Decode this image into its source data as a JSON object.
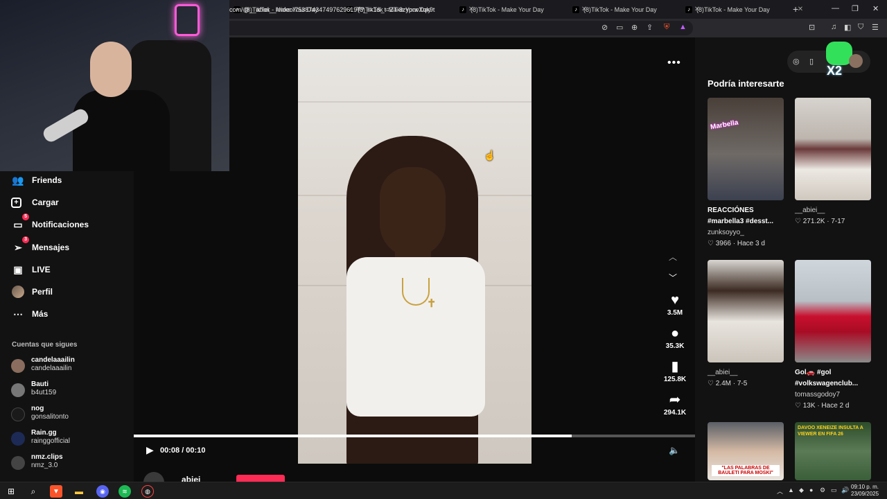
{
  "browser": {
    "tabs": [
      {
        "title": "(8)TikTok - Make Your Day"
      },
      {
        "title": "(8)TikTok - Make Your Day"
      },
      {
        "title": "(8)TikTok - Make Your Day"
      },
      {
        "title": "(8)TikTok - Make Your Day"
      },
      {
        "title": "(8)TikTok - Make Your Day"
      }
    ],
    "url": "com/@__abiei__/video/7538743474976296197?_r=1&_t=ZT-8zyprwXqk9t",
    "window_controls": {
      "minimize": "—",
      "restore": "❐",
      "close": "✕"
    }
  },
  "sidebar": {
    "nav": [
      {
        "label": "Friends",
        "icon": "friends-icon",
        "glyph": "👥"
      },
      {
        "label": "Cargar",
        "icon": "upload-icon",
        "glyph": "⊞"
      },
      {
        "label": "Notificaciones",
        "icon": "inbox-icon",
        "glyph": "💬",
        "badge": "5"
      },
      {
        "label": "Mensajes",
        "icon": "send-icon",
        "glyph": "➢",
        "badge": "3"
      },
      {
        "label": "LIVE",
        "icon": "live-icon",
        "glyph": "📺"
      },
      {
        "label": "Perfil",
        "icon": "profile-avatar-icon",
        "glyph": ""
      },
      {
        "label": "Más",
        "icon": "more-icon",
        "glyph": "⋯"
      }
    ],
    "following_title": "Cuentas que sigues",
    "following": [
      {
        "name": "candelaaailin",
        "handle": "candelaaailin"
      },
      {
        "name": "Bauti",
        "handle": "b4ut159"
      },
      {
        "name": "nog",
        "handle": "gonsalitonto"
      },
      {
        "name": "Rain.gg",
        "handle": "rainggofficial"
      },
      {
        "name": "nmz.clips",
        "handle": "nmz_3.0"
      }
    ]
  },
  "video": {
    "likes": "3.5M",
    "comments": "35.3K",
    "saves": "125.8K",
    "shares": "294.1K",
    "time": "00:08 / 00:10",
    "progress": 0.78,
    "creator": "abiei"
  },
  "recommend": {
    "title": "Podría interesarte",
    "x2": "X2",
    "cards": [
      {
        "title": "REACCIÓNES #marbella3 #desst...",
        "user": "zunksoyyo_",
        "stats": "3966 · Hace 3 d",
        "thumb_label": "Marbella"
      },
      {
        "title": "",
        "user": "__abiei__",
        "stats": "271.2K · 7-17",
        "thumb_label": ""
      },
      {
        "title": "",
        "user": "__abiei__",
        "stats": "2.4M · 7-5",
        "thumb_label": ""
      },
      {
        "title": "Gol🚗 #gol #volkswagenclub...",
        "user": "tomassgodoy7",
        "stats": "13K · Hace 2 d",
        "thumb_label": ""
      },
      {
        "title": "",
        "user": "",
        "stats": "",
        "thumb_label": "\"LAS PALABRAS DE BAULETI PARA MOSKI\""
      },
      {
        "title": "",
        "user": "",
        "stats": "",
        "thumb_label": "DAVOO XENEIZE INSULTA A VIEWER EN FIFA 26"
      }
    ]
  },
  "taskbar": {
    "time": "09:10 p. m.",
    "date": "23/09/2025"
  },
  "colors": {
    "accent": "#fe2c55",
    "bg": "#121212"
  }
}
